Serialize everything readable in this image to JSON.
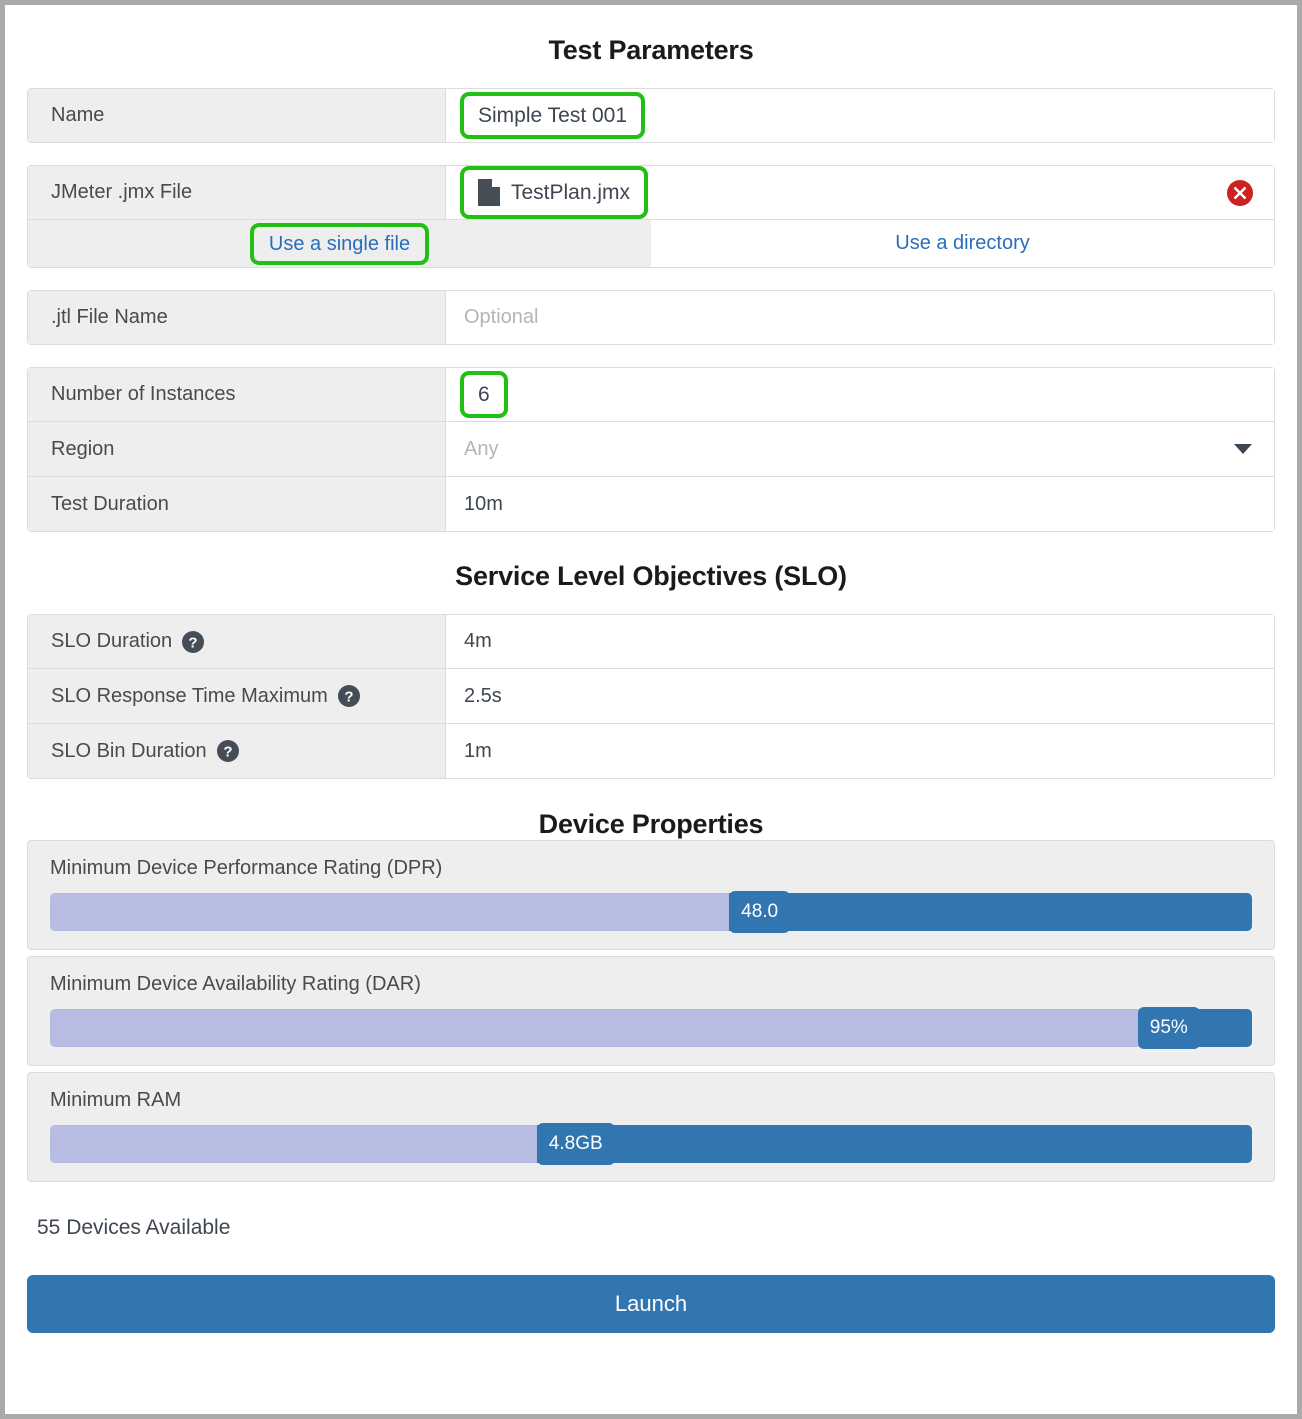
{
  "sections": {
    "test_parameters_title": "Test Parameters",
    "slo_title": "Service Level Objectives (SLO)",
    "device_title": "Device Properties"
  },
  "test_parameters": {
    "name": {
      "label": "Name",
      "value": "Simple Test 001"
    },
    "jmx_file": {
      "label": "JMeter .jmx File",
      "value": "TestPlan.jmx",
      "file_icon": "file-icon",
      "delete_icon": "delete-icon"
    },
    "file_source_toggle": {
      "single_file": "Use a single file",
      "directory": "Use a directory",
      "selected": "Use a single file"
    },
    "jtl_file": {
      "label": ".jtl File Name",
      "placeholder": "Optional",
      "value": ""
    },
    "instances": {
      "label": "Number of Instances",
      "value": "6"
    },
    "region": {
      "label": "Region",
      "placeholder": "Any",
      "value": "",
      "caret_icon": "chevron-down-icon"
    },
    "duration": {
      "label": "Test Duration",
      "value": "10m"
    }
  },
  "slo": {
    "duration": {
      "label": "SLO Duration",
      "value": "4m",
      "help_icon": "help-icon"
    },
    "response_time_max": {
      "label": "SLO Response Time Maximum",
      "value": "2.5s",
      "help_icon": "help-icon"
    },
    "bin_duration": {
      "label": "SLO Bin Duration",
      "value": "1m",
      "help_icon": "help-icon"
    }
  },
  "device_properties": {
    "dpr": {
      "label": "Minimum Device Performance Rating (DPR)",
      "value": "48.0",
      "percent": 56.5
    },
    "dar": {
      "label": "Minimum Device Availability Rating (DAR)",
      "value": "95%",
      "percent": 94.5
    },
    "ram": {
      "label": "Minimum RAM",
      "value": "4.8GB",
      "percent": 40.5
    }
  },
  "footer": {
    "devices_available": "55 Devices Available",
    "launch_label": "Launch"
  },
  "colors": {
    "accent_blue": "#3276b1",
    "link_blue": "#2a6ebb",
    "slider_left": "#b6bce2",
    "highlight_green": "#22c015",
    "delete_red": "#cc2222",
    "label_bg": "#eeeeee"
  }
}
